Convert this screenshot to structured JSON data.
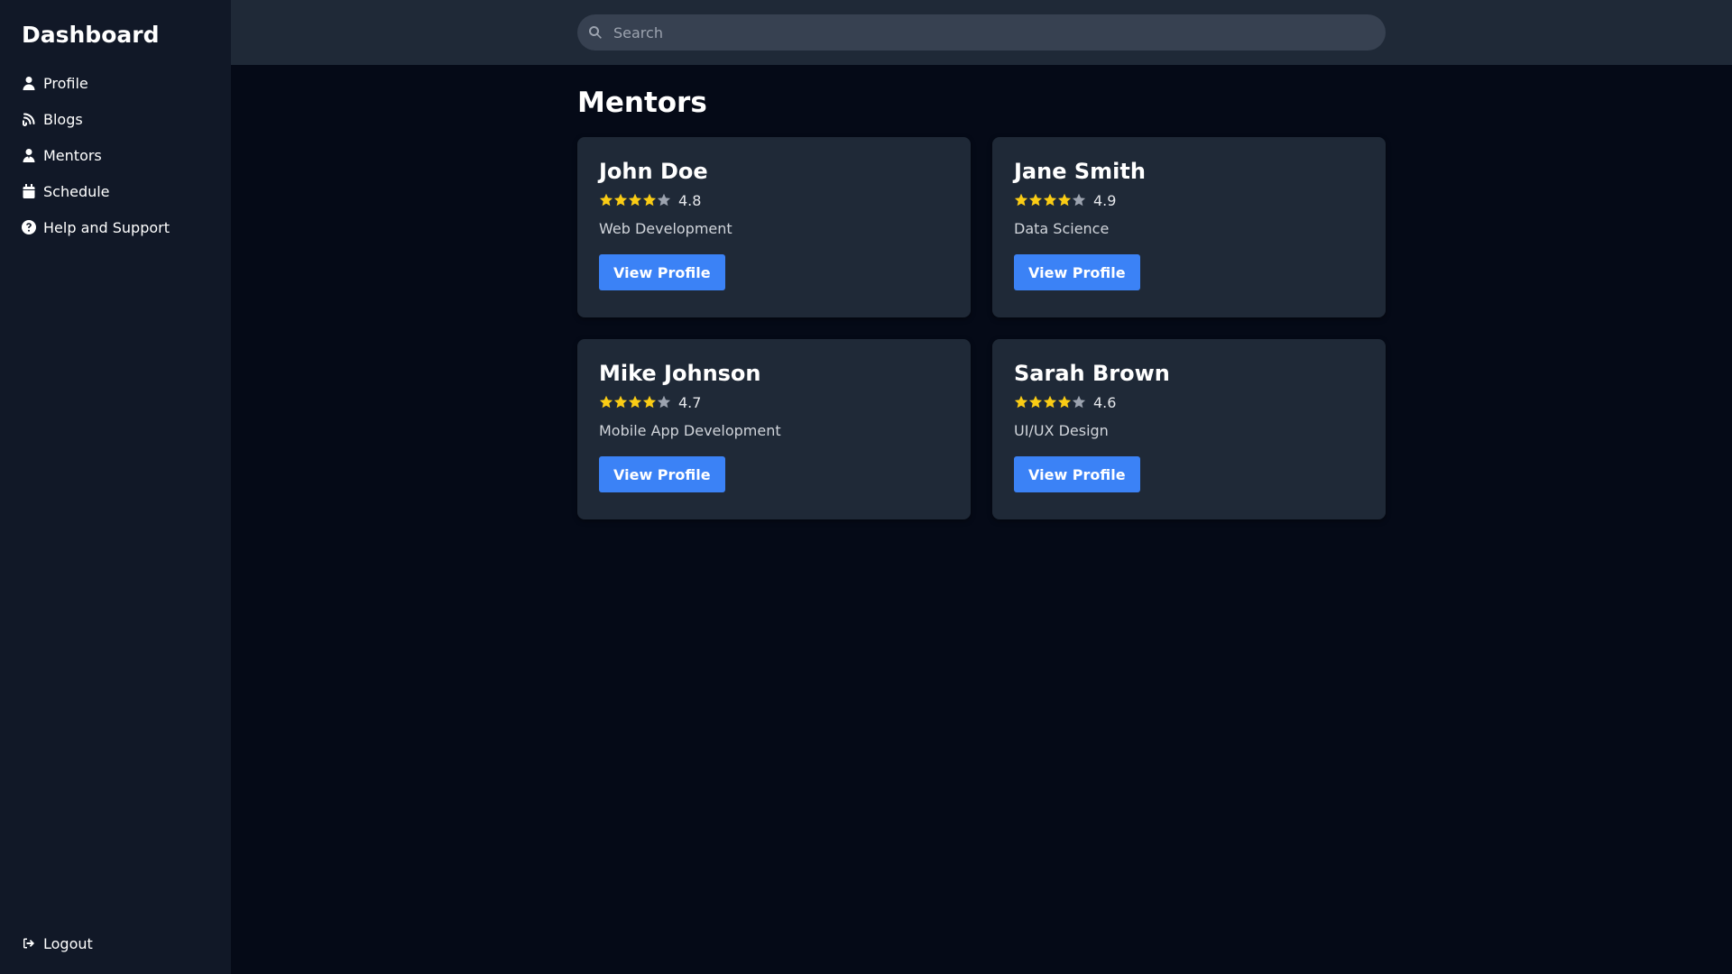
{
  "sidebar": {
    "title": "Dashboard",
    "items": [
      {
        "label": "Profile",
        "icon": "user-icon"
      },
      {
        "label": "Blogs",
        "icon": "blog-icon"
      },
      {
        "label": "Mentors",
        "icon": "mentor-icon"
      },
      {
        "label": "Schedule",
        "icon": "calendar-icon"
      },
      {
        "label": "Help and Support",
        "icon": "help-icon"
      }
    ],
    "logout": {
      "label": "Logout",
      "icon": "logout-icon"
    }
  },
  "search": {
    "placeholder": "Search",
    "value": ""
  },
  "main": {
    "title": "Mentors",
    "mentors": [
      {
        "name": "John Doe",
        "rating": "4.8",
        "stars_filled": 4,
        "stars_total": 5,
        "specialty": "Web Development",
        "button": "View Profile"
      },
      {
        "name": "Jane Smith",
        "rating": "4.9",
        "stars_filled": 4,
        "stars_total": 5,
        "specialty": "Data Science",
        "button": "View Profile"
      },
      {
        "name": "Mike Johnson",
        "rating": "4.7",
        "stars_filled": 4,
        "stars_total": 5,
        "specialty": "Mobile App Development",
        "button": "View Profile"
      },
      {
        "name": "Sarah Brown",
        "rating": "4.6",
        "stars_filled": 4,
        "stars_total": 5,
        "specialty": "UI/UX Design",
        "button": "View Profile"
      }
    ]
  },
  "colors": {
    "star_filled": "#facc15",
    "star_empty": "#9ca3af",
    "accent": "#3b82f6"
  }
}
